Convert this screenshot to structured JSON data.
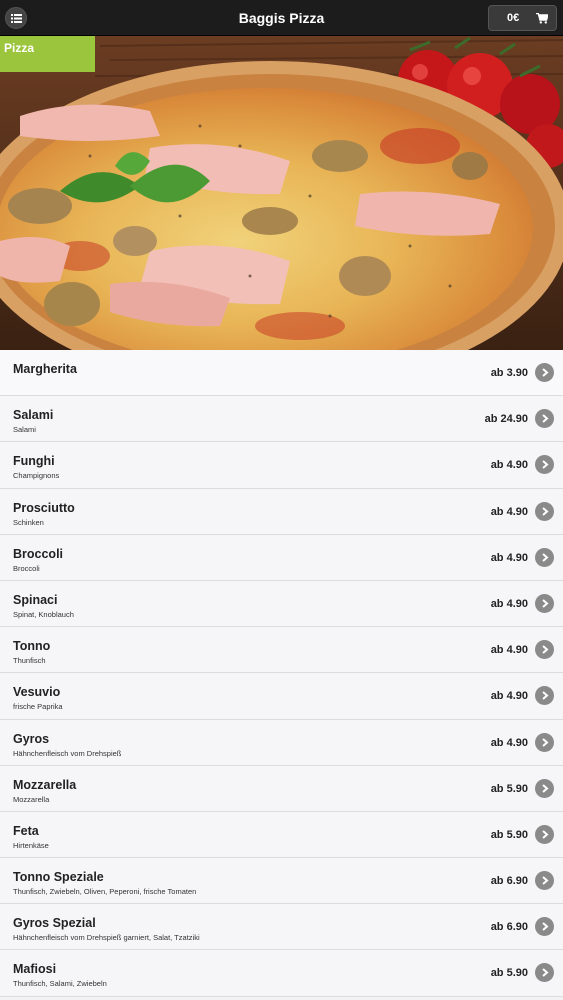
{
  "header": {
    "title": "Baggis Pizza",
    "cart_total": "0€",
    "menu_icon": "menu-icon",
    "cart_icon": "cart-icon"
  },
  "hero": {
    "category": "Pizza"
  },
  "menu_items": [
    {
      "name": "Margherita",
      "desc": "",
      "price": "ab 3.90"
    },
    {
      "name": "Salami",
      "desc": "Salami",
      "price": "ab 24.90"
    },
    {
      "name": "Funghi",
      "desc": "Champignons",
      "price": "ab 4.90"
    },
    {
      "name": "Prosciutto",
      "desc": "Schinken",
      "price": "ab 4.90"
    },
    {
      "name": "Broccoli",
      "desc": "Broccoli",
      "price": "ab 4.90"
    },
    {
      "name": "Spinaci",
      "desc": "Spinat, Knoblauch",
      "price": "ab 4.90"
    },
    {
      "name": "Tonno",
      "desc": "Thunfisch",
      "price": "ab 4.90"
    },
    {
      "name": "Vesuvio",
      "desc": "frische Paprika",
      "price": "ab 4.90"
    },
    {
      "name": "Gyros",
      "desc": "Hähnchenfleisch vom Drehspieß",
      "price": "ab 4.90"
    },
    {
      "name": "Mozzarella",
      "desc": "Mozzarella",
      "price": "ab 5.90"
    },
    {
      "name": "Feta",
      "desc": "Hirtenkäse",
      "price": "ab 5.90"
    },
    {
      "name": "Tonno Speziale",
      "desc": "Thunfisch, Zwiebeln, Oliven, Peperoni, frische Tomaten",
      "price": "ab 6.90"
    },
    {
      "name": "Gyros Spezial",
      "desc": "Hähnchenfleisch vom Drehspieß garniert, Salat, Tzatziki",
      "price": "ab 6.90"
    },
    {
      "name": "Mafiosi",
      "desc": "Thunfisch, Salami, Zwiebeln",
      "price": "ab 5.90"
    }
  ]
}
